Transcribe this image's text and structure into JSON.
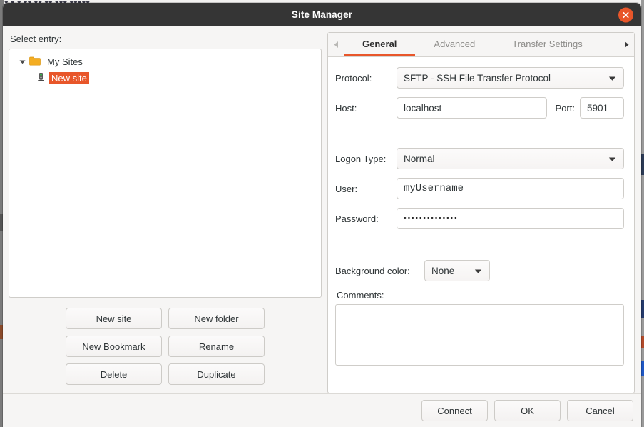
{
  "background_window": {
    "toolbar_hint_text": "▾ ▾ ▾ ▾▾ ▾▾ ▾▾ ▾▾▾ ▾▾▾▾▾"
  },
  "dialog": {
    "title": "Site Manager",
    "close_icon": "close-icon"
  },
  "left_pane": {
    "select_entry_label": "Select entry:",
    "tree": {
      "root": {
        "label": "My Sites",
        "icon": "folder-icon",
        "expanded": true,
        "twisty_icon": "chevron-down-icon"
      },
      "children": [
        {
          "label": "New site",
          "icon": "server-icon",
          "selected": true
        }
      ]
    },
    "buttons": [
      {
        "label": "New site"
      },
      {
        "label": "New folder"
      },
      {
        "label": "New Bookmark"
      },
      {
        "label": "Rename"
      },
      {
        "label": "Delete"
      },
      {
        "label": "Duplicate"
      }
    ]
  },
  "right_pane": {
    "tabs": {
      "scroll_left_icon": "triangle-left-icon",
      "scroll_right_icon": "triangle-right-icon",
      "items": [
        {
          "label": "General",
          "active": true
        },
        {
          "label": "Advanced",
          "active": false
        },
        {
          "label": "Transfer Settings",
          "active": false
        }
      ]
    },
    "form": {
      "protocol_label": "Protocol:",
      "protocol_value": "SFTP - SSH File Transfer Protocol",
      "host_label": "Host:",
      "host_value": "localhost",
      "host_placeholder": "",
      "port_label": "Port:",
      "port_value": "5901",
      "port_placeholder": "",
      "logon_type_label": "Logon Type:",
      "logon_type_value": "Normal",
      "user_label": "User:",
      "user_value": "myUsername",
      "user_placeholder": "",
      "password_label": "Password:",
      "password_value": "••••••••••••••",
      "password_placeholder": "",
      "background_color_label": "Background color:",
      "background_color_value": "None",
      "comments_label": "Comments:",
      "comments_value": "",
      "comments_placeholder": ""
    }
  },
  "footer": {
    "buttons": [
      {
        "label": "Connect"
      },
      {
        "label": "OK"
      },
      {
        "label": "Cancel"
      }
    ]
  },
  "colors": {
    "accent": "#e8562a",
    "titlebar": "#353535",
    "dialog_bg": "#f6f5f4",
    "field_border": "#cfcdc9",
    "text": "#2e3436",
    "tab_inactive_text": "#8d8c89",
    "folder_icon": "#f4ad22"
  }
}
